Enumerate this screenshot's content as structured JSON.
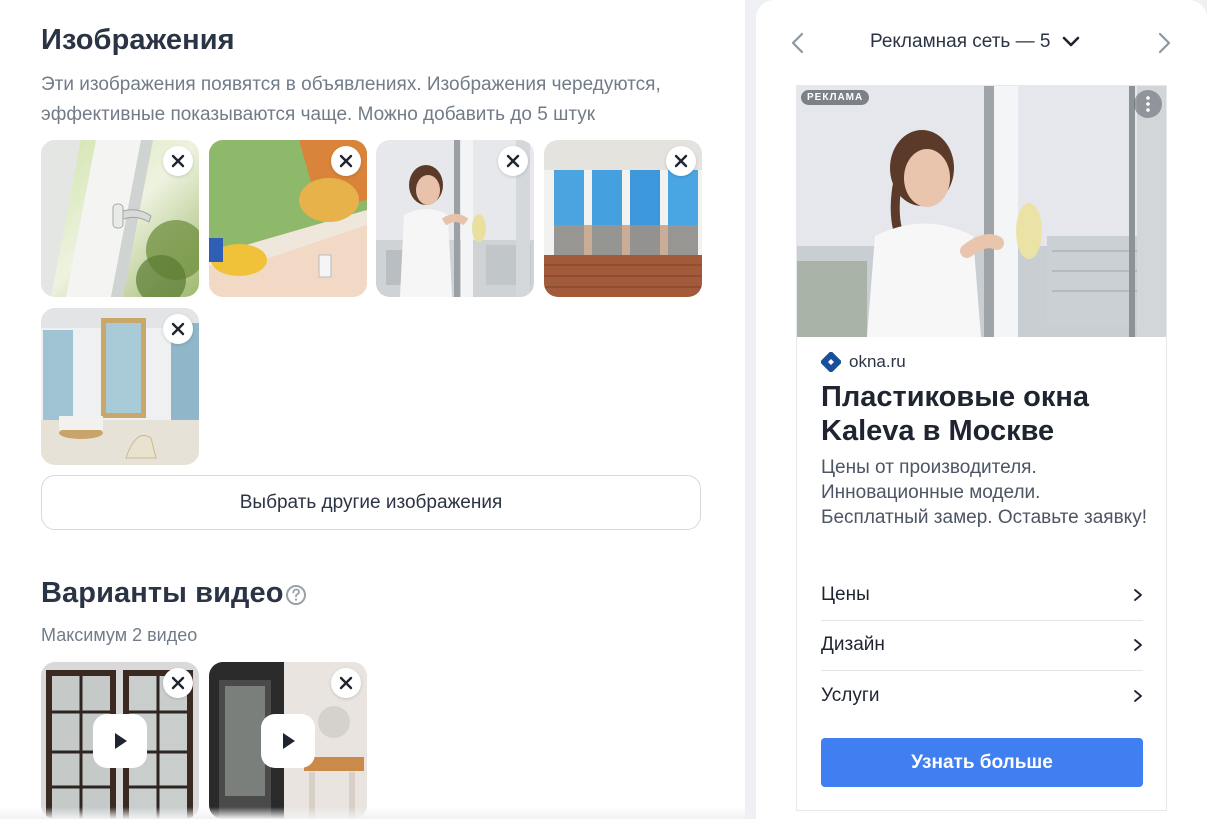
{
  "images_section": {
    "title": "Изображения",
    "description": "Эти изображения появятся в объявлениях. Изображения чередуются, эффективные показываются чаще. Можно добавить до 5 штук",
    "choose_button": "Выбрать другие изображения",
    "thumbnails": [
      "window-handle-image",
      "cleaning-window-image",
      "woman-window-image",
      "balcony-windows-image",
      "interior-room-image"
    ]
  },
  "video_section": {
    "title": "Варианты видео",
    "subtitle": "Максимум 2 видео",
    "videos": [
      "glass-doors-video",
      "door-interior-video"
    ]
  },
  "preview": {
    "nav_title": "Рекламная сеть — 5",
    "ad": {
      "badge": "РЕКЛАМА",
      "domain": "okna.ru",
      "title": "Пластиковые окна Kaleva в Москве",
      "text": "Цены от производителя. Инновационные модели. Бесплатный замер. Оставьте заявку!",
      "sitelinks": [
        "Цены",
        "Дизайн",
        "Услуги"
      ],
      "cta": "Узнать больше"
    }
  },
  "colors": {
    "accent": "#3f7ff2",
    "title": "#2b3444",
    "muted": "#727b88",
    "background": "#eef0f3"
  }
}
